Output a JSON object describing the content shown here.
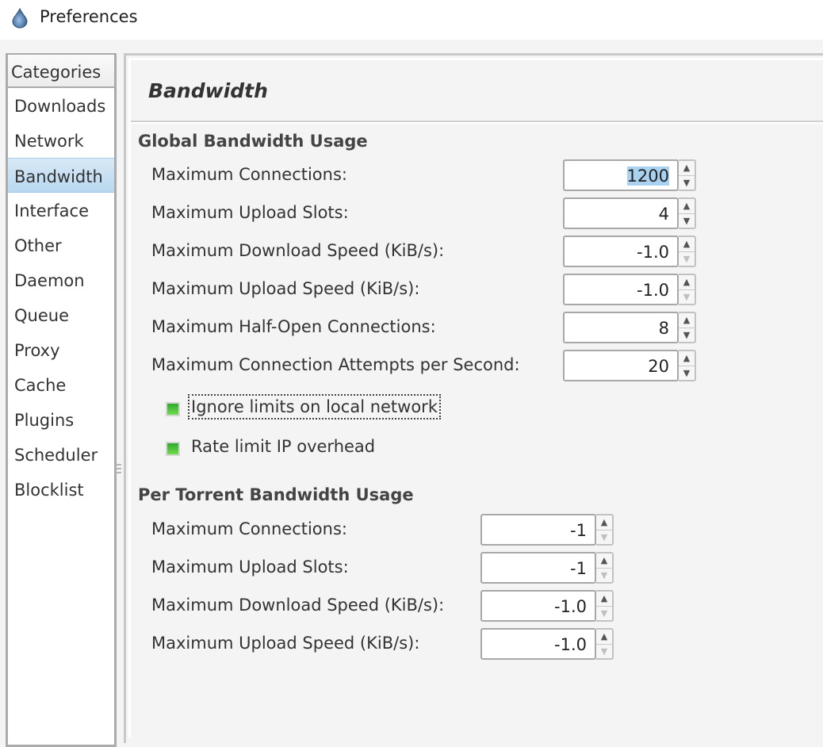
{
  "window": {
    "title": "Preferences",
    "icon": "deluge-drop-icon"
  },
  "sidebar": {
    "header": "Categories",
    "items": [
      {
        "label": "Downloads",
        "selected": false
      },
      {
        "label": "Network",
        "selected": false
      },
      {
        "label": "Bandwidth",
        "selected": true
      },
      {
        "label": "Interface",
        "selected": false
      },
      {
        "label": "Other",
        "selected": false
      },
      {
        "label": "Daemon",
        "selected": false
      },
      {
        "label": "Queue",
        "selected": false
      },
      {
        "label": "Proxy",
        "selected": false
      },
      {
        "label": "Cache",
        "selected": false
      },
      {
        "label": "Plugins",
        "selected": false
      },
      {
        "label": "Scheduler",
        "selected": false
      },
      {
        "label": "Blocklist",
        "selected": false
      }
    ]
  },
  "main": {
    "title": "Bandwidth",
    "global": {
      "heading": "Global Bandwidth Usage",
      "fields": [
        {
          "label": "Maximum Connections:",
          "value": "1200",
          "down_enabled": true,
          "selected": true
        },
        {
          "label": "Maximum Upload Slots:",
          "value": "4",
          "down_enabled": true
        },
        {
          "label": "Maximum Download Speed (KiB/s):",
          "value": "-1.0",
          "down_enabled": false
        },
        {
          "label": "Maximum Upload Speed (KiB/s):",
          "value": "-1.0",
          "down_enabled": false
        },
        {
          "label": "Maximum Half-Open Connections:",
          "value": "8",
          "down_enabled": true
        },
        {
          "label": "Maximum Connection Attempts per Second:",
          "value": "20",
          "down_enabled": true
        }
      ],
      "checkboxes": [
        {
          "label": "Ignore limits on local network",
          "checked": true,
          "focused": true
        },
        {
          "label": "Rate limit IP overhead",
          "checked": true
        }
      ]
    },
    "per_torrent": {
      "heading": "Per Torrent Bandwidth Usage",
      "fields": [
        {
          "label": "Maximum Connections:",
          "value": "-1",
          "down_enabled": false
        },
        {
          "label": "Maximum Upload Slots:",
          "value": "-1",
          "down_enabled": false
        },
        {
          "label": "Maximum Download Speed (KiB/s):",
          "value": "-1.0",
          "down_enabled": false
        },
        {
          "label": "Maximum Upload Speed (KiB/s):",
          "value": "-1.0",
          "down_enabled": false
        }
      ]
    }
  },
  "icons": {
    "up": "▲",
    "down": "▼"
  }
}
